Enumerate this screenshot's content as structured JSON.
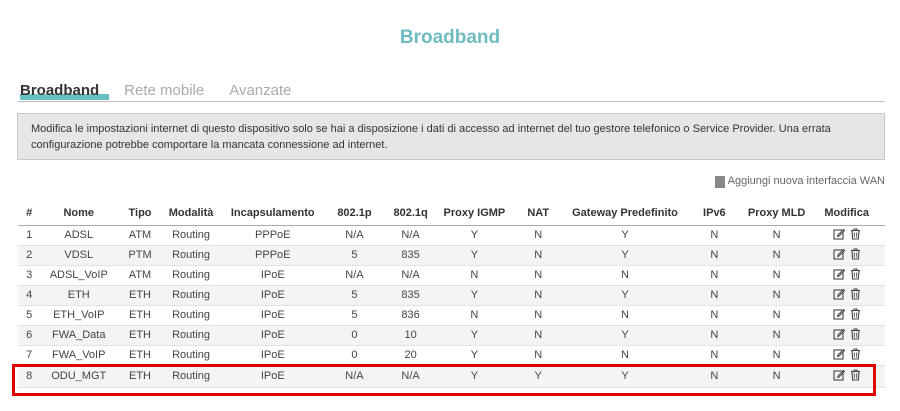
{
  "header": {
    "title": "Broadband"
  },
  "tabs": [
    {
      "label": "Broadband",
      "active": true
    },
    {
      "label": "Rete mobile",
      "active": false
    },
    {
      "label": "Avanzate",
      "active": false
    }
  ],
  "notice": {
    "text": "Modifica le impostazioni internet di questo dispositivo solo se hai a disposizione i dati di accesso ad internet del tuo gestore telefonico o Service Provider. Una errata configurazione potrebbe comportare la mancata connessione ad internet."
  },
  "add_link": {
    "label": "Aggiungi nuova interfaccia WAN",
    "icon": "add-icon"
  },
  "table": {
    "columns": [
      "#",
      "Nome",
      "Tipo",
      "Modalità",
      "Incapsulamento",
      "802.1p",
      "802.1q",
      "Proxy IGMP",
      "NAT",
      "Gateway Predefinito",
      "IPv6",
      "Proxy MLD",
      "Modifica"
    ],
    "rows": [
      [
        "1",
        "ADSL",
        "ATM",
        "Routing",
        "PPPoE",
        "N/A",
        "N/A",
        "Y",
        "N",
        "Y",
        "N",
        "N"
      ],
      [
        "2",
        "VDSL",
        "PTM",
        "Routing",
        "PPPoE",
        "5",
        "835",
        "Y",
        "N",
        "Y",
        "N",
        "N"
      ],
      [
        "3",
        "ADSL_VoIP",
        "ATM",
        "Routing",
        "IPoE",
        "N/A",
        "N/A",
        "N",
        "N",
        "N",
        "N",
        "N"
      ],
      [
        "4",
        "ETH",
        "ETH",
        "Routing",
        "IPoE",
        "5",
        "835",
        "Y",
        "N",
        "Y",
        "N",
        "N"
      ],
      [
        "5",
        "ETH_VoIP",
        "ETH",
        "Routing",
        "IPoE",
        "5",
        "836",
        "N",
        "N",
        "N",
        "N",
        "N"
      ],
      [
        "6",
        "FWA_Data",
        "ETH",
        "Routing",
        "IPoE",
        "0",
        "10",
        "Y",
        "N",
        "Y",
        "N",
        "N"
      ],
      [
        "7",
        "FWA_VoIP",
        "ETH",
        "Routing",
        "IPoE",
        "0",
        "20",
        "Y",
        "N",
        "N",
        "N",
        "N"
      ],
      [
        "8",
        "ODU_MGT",
        "ETH",
        "Routing",
        "IPoE",
        "N/A",
        "N/A",
        "Y",
        "Y",
        "Y",
        "N",
        "N"
      ]
    ],
    "row_actions": [
      "edit-icon",
      "trash-icon"
    ]
  },
  "colors": {
    "accent": "#5ab8bd",
    "title": "#6fbcc0",
    "highlight": "#e00000"
  }
}
